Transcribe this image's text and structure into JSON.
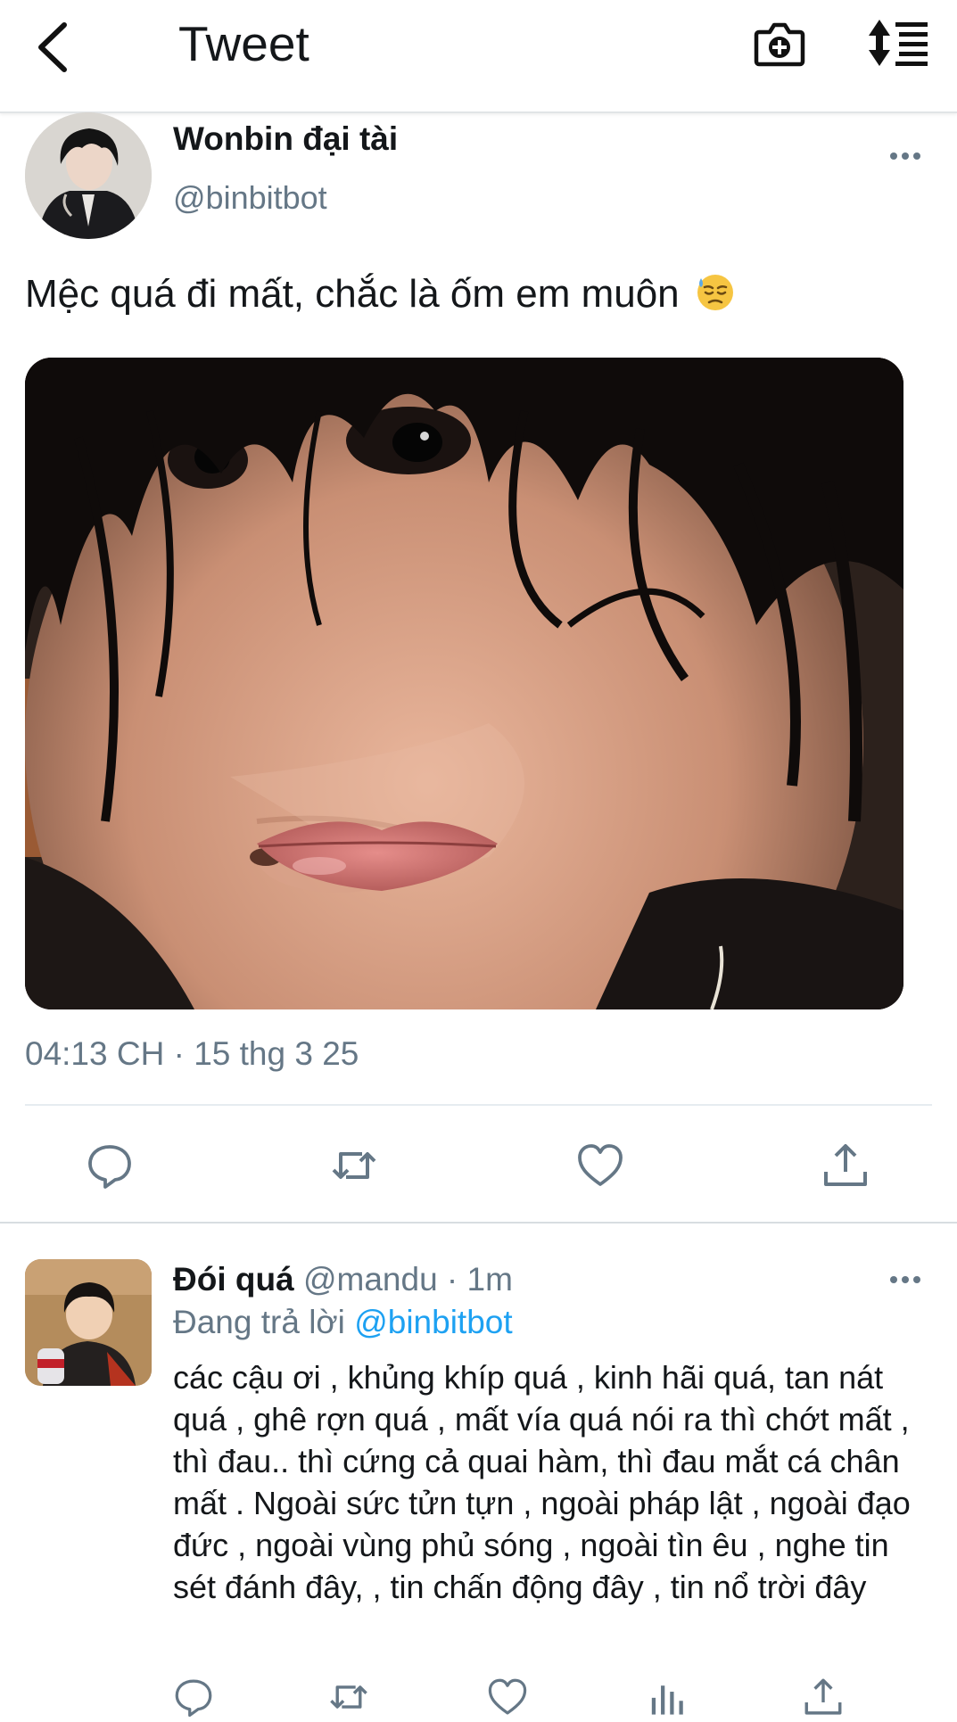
{
  "header": {
    "title": "Tweet",
    "back_icon": "chevron-left-icon",
    "camera_icon": "camera-plus-icon",
    "sort_icon": "sort-list-icon"
  },
  "tweet": {
    "author_name": "Wonbin đại tài",
    "author_handle": "@binbitbot",
    "text": "Mệc quá đi mất, chắc là ốm em muôn",
    "emoji": "downcast-face-with-sweat-emoji",
    "timestamp": "04:13 CH · 15 thg 3 25",
    "actions": [
      "reply-icon",
      "retweet-icon",
      "like-icon",
      "share-icon"
    ]
  },
  "reply": {
    "author_name": "Đói quá",
    "author_handle": "@mandu",
    "separator": " · ",
    "time": "1m",
    "replying_prefix": "Đang trả lời ",
    "replying_to": "@binbitbot",
    "text": "các cậu ơi , khủng khíp quá , kinh hãi quá, tan nát quá , ghê rợn quá , mất vía quá nói ra thì chớt mất , thì đau.. thì cứng cả quai hàm, thì đau mắt cá chân mất . Ngoài sức tửn tựn , ngoài pháp lật , ngoài đạo đức , ngoài vùng phủ sóng , ngoài tìn êu , nghe tin sét đánh đây, , tin chấn động đây , tin nổ trời đây",
    "actions": [
      "reply-icon",
      "retweet-icon",
      "like-icon",
      "analytics-icon",
      "share-icon"
    ]
  },
  "colors": {
    "text": "#14171a",
    "secondary": "#657786",
    "link": "#1da1f2",
    "divider": "#e6ecf0"
  }
}
